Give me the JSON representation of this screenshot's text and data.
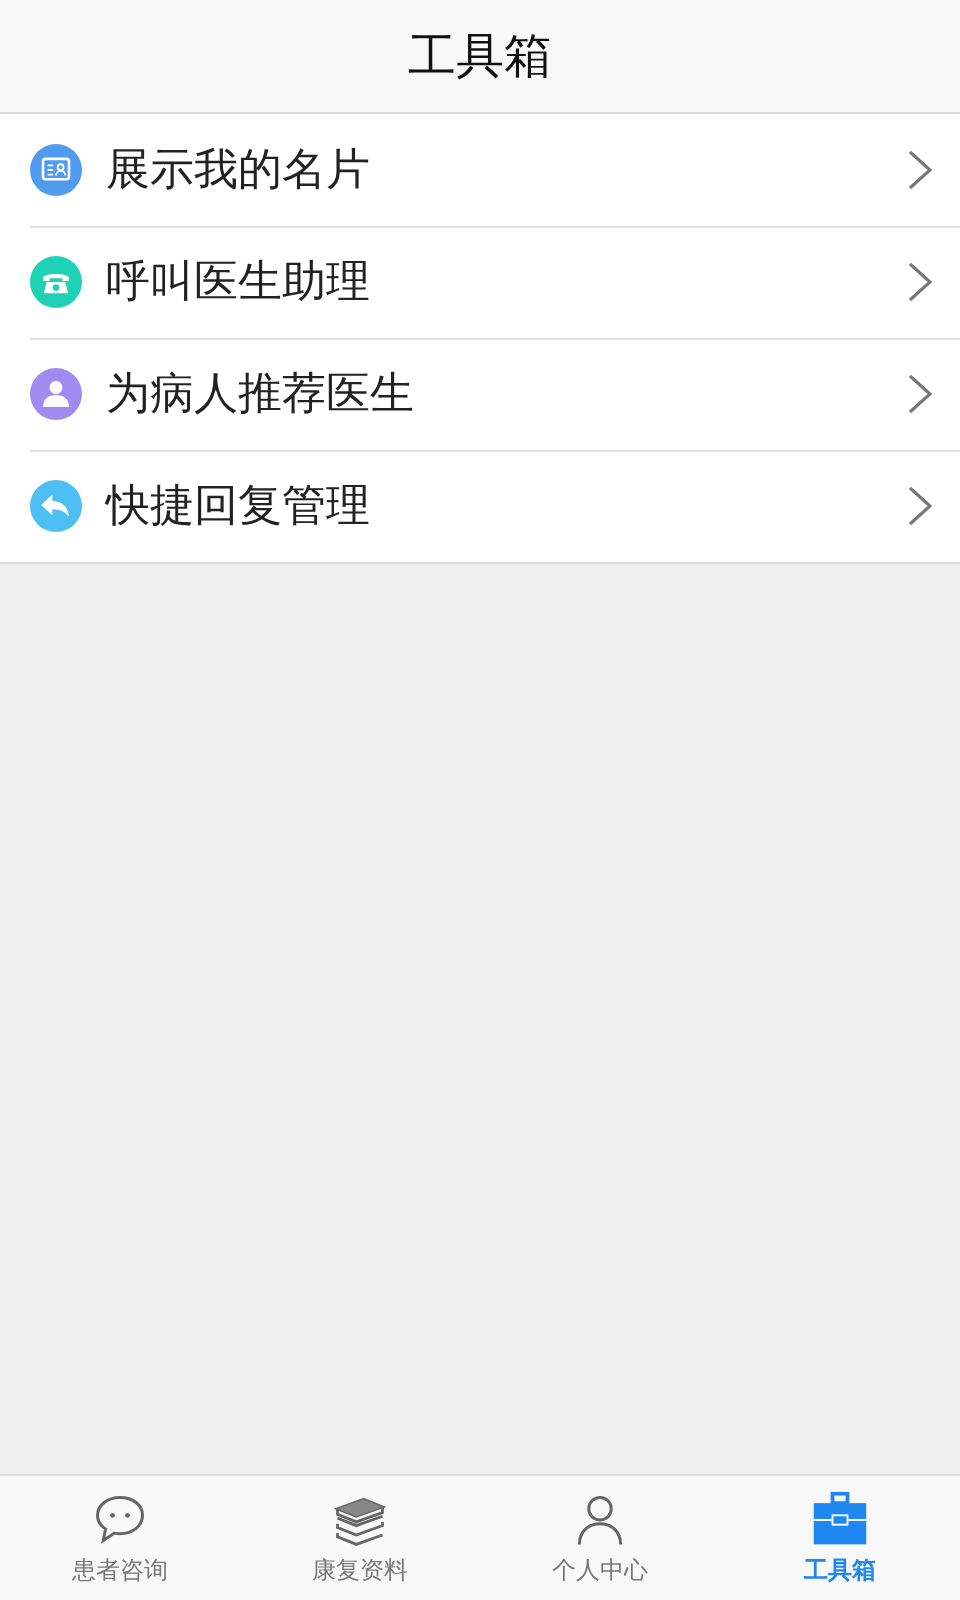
{
  "header": {
    "title": "工具箱"
  },
  "items": [
    {
      "label": "展示我的名片",
      "kind": "card",
      "color": "#4f9bf0"
    },
    {
      "label": "呼叫医生助理",
      "kind": "phone",
      "color": "#1fd1b5"
    },
    {
      "label": "为病人推荐医生",
      "kind": "doctor",
      "color": "#a08cf0"
    },
    {
      "label": "快捷回复管理",
      "kind": "reply",
      "color": "#4dbff5"
    }
  ],
  "tabs": [
    {
      "label": "患者咨询",
      "kind": "chat",
      "selected": false
    },
    {
      "label": "康复资料",
      "kind": "books",
      "selected": false
    },
    {
      "label": "个人中心",
      "kind": "person",
      "selected": false
    },
    {
      "label": "工具箱",
      "kind": "toolbox",
      "selected": true
    }
  ]
}
